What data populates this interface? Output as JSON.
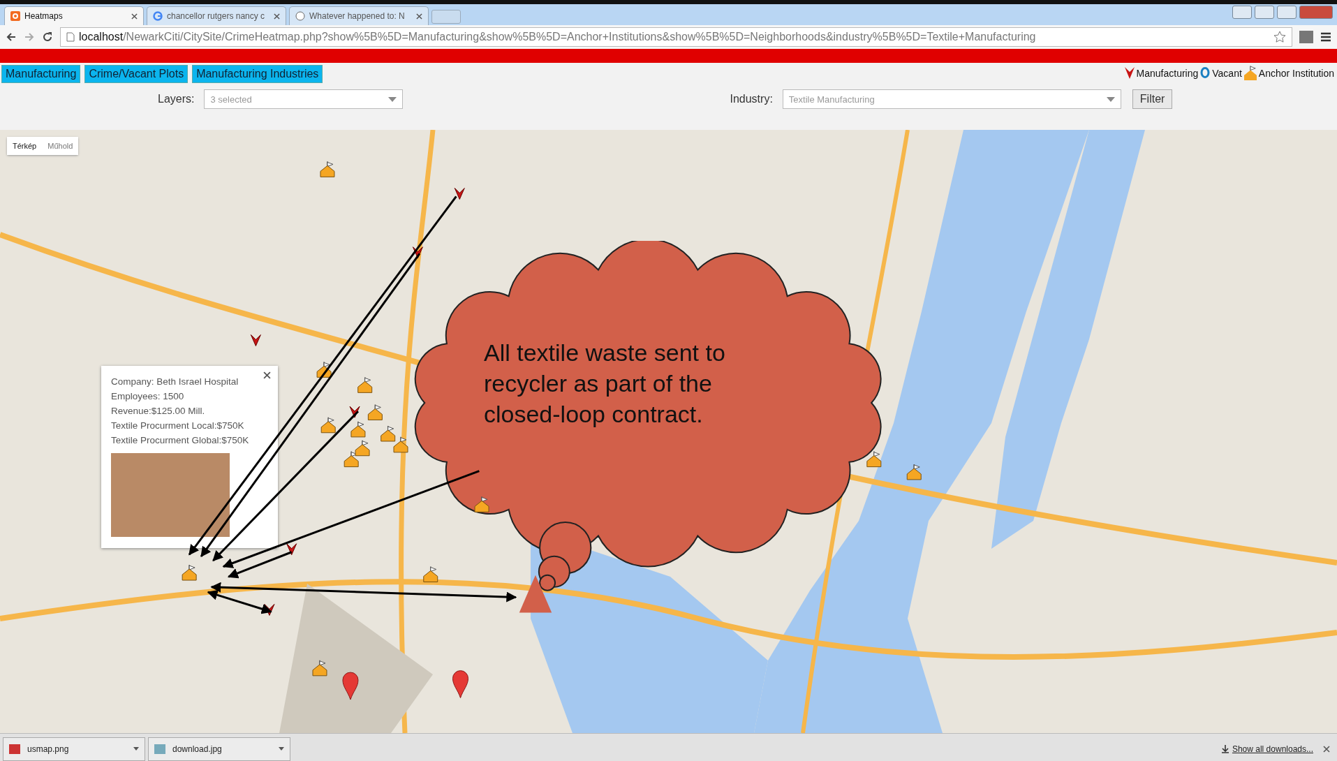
{
  "browser": {
    "tabs": [
      {
        "title": "Heatmaps",
        "selected": true
      },
      {
        "title": "chancellor rutgers nancy c",
        "selected": false
      },
      {
        "title": "Whatever happened to: N",
        "selected": false
      }
    ],
    "url_host": "localhost",
    "url_path": "/NewarkCiti/CitySite/CrimeHeatmap.php?show%5B%5D=Manufacturing&show%5B%5D=Anchor+Institutions&show%5B%5D=Neighborhoods&industry%5B%5D=Textile+Manufacturing"
  },
  "nav": [
    {
      "label": "Manufacturing"
    },
    {
      "label": "Crime/Vacant Plots"
    },
    {
      "label": "Manufacturing Industries"
    }
  ],
  "legend": [
    {
      "kind": "manufacturing",
      "label": "Manufacturing"
    },
    {
      "kind": "vacant",
      "label": "Vacant"
    },
    {
      "kind": "anchor",
      "label": "Anchor Institution"
    }
  ],
  "filters": {
    "layers_label": "Layers:",
    "layers_value": "3 selected",
    "industry_label": "Industry:",
    "industry_value": "Textile Manufacturing",
    "button": "Filter"
  },
  "map": {
    "map_types": [
      {
        "label": "Térkép",
        "selected": true
      },
      {
        "label": "Műhold",
        "selected": false
      }
    ],
    "info_window": {
      "lines": [
        "Company: Beth Israel Hospital",
        "Employees: 1500",
        "Revenue:$125.00 Mill.",
        "Textile Procurment Local:$750K",
        "Textile Procurment Global:$750K"
      ]
    },
    "callout": "All textile waste sent to recycler as part of the closed-loop contract."
  },
  "downloads": {
    "files": [
      "usmap.png",
      "download.jpg"
    ],
    "show_all": "Show all downloads..."
  }
}
